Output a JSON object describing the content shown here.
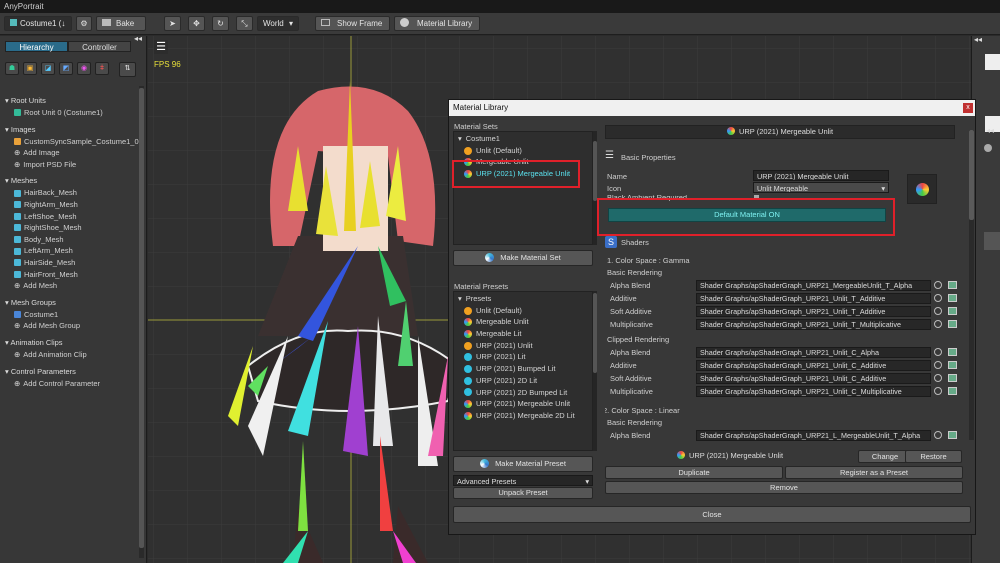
{
  "app": {
    "title": "AnyPortrait"
  },
  "toolbar": {
    "costume": "Costume1 (↓",
    "bake": "Bake",
    "space": "World",
    "show_frame": "Show Frame",
    "material_library": "Material Library"
  },
  "left_tabs": {
    "hierarchy": "Hierarchy",
    "controller": "Controller"
  },
  "hierarchy": {
    "root_units": {
      "title": "Root Units",
      "items": [
        "Root Unit 0 (Costume1)"
      ]
    },
    "images": {
      "title": "Images",
      "items": [
        "CustomSyncSample_Costume1_0",
        "Add Image",
        "Import PSD File"
      ]
    },
    "meshes": {
      "title": "Meshes",
      "items": [
        "HairBack_Mesh",
        "RightArm_Mesh",
        "LeftShoe_Mesh",
        "RightShoe_Mesh",
        "Body_Mesh",
        "LeftArm_Mesh",
        "HairSide_Mesh",
        "HairFront_Mesh",
        "Add Mesh"
      ]
    },
    "mesh_groups": {
      "title": "Mesh Groups",
      "items": [
        "Costume1",
        "Add Mesh Group"
      ]
    },
    "animation_clips": {
      "title": "Animation Clips",
      "items": [
        "Add Animation Clip"
      ]
    },
    "control_parameters": {
      "title": "Control Parameters",
      "items": [
        "Add Control Parameter"
      ]
    }
  },
  "viewport": {
    "fps": "FPS 96"
  },
  "dialog": {
    "title": "Material Library",
    "close_x": "x",
    "material_sets_label": "Material Sets",
    "sets_root": "Costume1",
    "sets": [
      {
        "label": "Unlit (Default)",
        "color": "#f0a020"
      },
      {
        "label": "Mergeable Unlit",
        "color": "multi"
      },
      {
        "label": "URP (2021) Mergeable Unlit",
        "color": "multi",
        "selected": true
      }
    ],
    "make_material_set": "Make Material Set",
    "material_presets_label": "Material Presets",
    "presets_root": "Presets",
    "presets": [
      {
        "label": "Unlit (Default)",
        "color": "#f0a020"
      },
      {
        "label": "Mergeable Unlit",
        "color": "multi"
      },
      {
        "label": "Mergeable Lit",
        "color": "multi"
      },
      {
        "label": "URP (2021) Unlit",
        "color": "#f0a020"
      },
      {
        "label": "URP (2021) Lit",
        "color": "#30c0e0"
      },
      {
        "label": "URP (2021) Bumped Lit",
        "color": "#30c0e0"
      },
      {
        "label": "URP (2021) 2D Lit",
        "color": "#30c0e0"
      },
      {
        "label": "URP (2021) 2D Bumped Lit",
        "color": "#30c0e0"
      },
      {
        "label": "URP (2021) Mergeable Unlit",
        "color": "multi"
      },
      {
        "label": "URP (2021) Mergeable 2D Lit",
        "color": "multi"
      }
    ],
    "make_material_preset": "Make Material Preset",
    "advanced_presets": "Advanced Presets",
    "unpack_preset": "Unpack Preset",
    "header_name": "URP (2021) Mergeable Unlit",
    "basic_properties": "Basic Properties",
    "name_label": "Name",
    "name_value": "URP (2021) Mergeable Unlit",
    "icon_label": "Icon",
    "icon_value": "Unlit Mergeable",
    "black_ambient": "Black Ambient Required",
    "default_material": "Default Material ON",
    "shaders": "Shaders",
    "color_space_gamma": "1. Color Space : Gamma",
    "basic_rendering": "Basic Rendering",
    "clipped_rendering": "Clipped Rendering",
    "color_space_linear": "2. Color Space : Linear",
    "gamma_basic": [
      {
        "name": "Alpha Blend",
        "path": "Shader Graphs/apShaderGraph_URP21_MergeableUnlit_T_Alpha"
      },
      {
        "name": "Additive",
        "path": "Shader Graphs/apShaderGraph_URP21_Unlit_T_Additive"
      },
      {
        "name": "Soft Additive",
        "path": "Shader Graphs/apShaderGraph_URP21_Unlit_T_Additive"
      },
      {
        "name": "Multiplicative",
        "path": "Shader Graphs/apShaderGraph_URP21_Unlit_T_Multiplicative"
      }
    ],
    "gamma_clipped": [
      {
        "name": "Alpha Blend",
        "path": "Shader Graphs/apShaderGraph_URP21_Unlit_C_Alpha"
      },
      {
        "name": "Additive",
        "path": "Shader Graphs/apShaderGraph_URP21_Unlit_C_Additive"
      },
      {
        "name": "Soft Additive",
        "path": "Shader Graphs/apShaderGraph_URP21_Unlit_C_Additive"
      },
      {
        "name": "Multiplicative",
        "path": "Shader Graphs/apShaderGraph_URP21_Unlit_C_Multiplicative"
      }
    ],
    "linear_basic": [
      {
        "name": "Alpha Blend",
        "path": "Shader Graphs/apShaderGraph_URP21_L_MergeableUnlit_T_Alpha"
      }
    ],
    "footer_name": "URP (2021) Mergeable Unlit",
    "change": "Change",
    "restore": "Restore",
    "duplicate": "Duplicate",
    "register_preset": "Register as a Preset",
    "remove": "Remove",
    "close": "Close"
  },
  "colors": {
    "accent": "#2a6b8a",
    "highlight": "#e0202a",
    "default_material_bg": "#1f6a6a"
  }
}
